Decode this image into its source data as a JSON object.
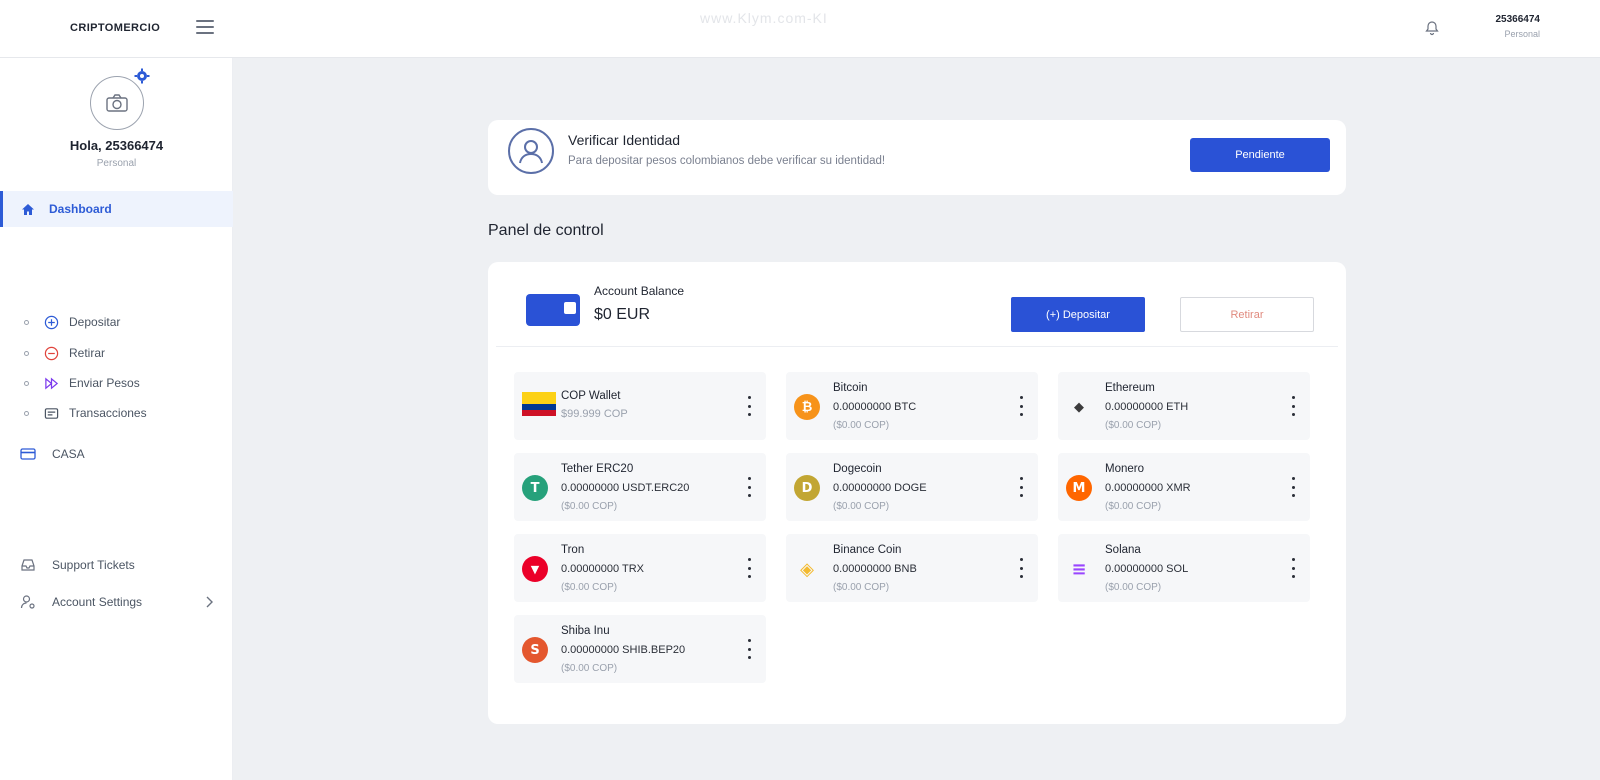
{
  "header": {
    "brand": "CRIPTOMERCIO",
    "watermark_url": "www.Klym.com-KI",
    "user_id": "25366474",
    "user_role": "Personal"
  },
  "sidebar": {
    "greeting": "Hola, 25366474",
    "account_type": "Personal",
    "active_item": "Dashboard",
    "sub_items": [
      {
        "label": "Depositar",
        "icon": "plus-circle-icon",
        "color": "#2d5bd6"
      },
      {
        "label": "Retirar",
        "icon": "minus-circle-icon",
        "color": "#e0433b"
      },
      {
        "label": "Enviar Pesos",
        "icon": "send-arrows-icon",
        "color": "#7c3aed"
      },
      {
        "label": "Transacciones",
        "icon": "list-icon",
        "color": "#4b5563"
      }
    ],
    "main_items": [
      {
        "label": "CASA",
        "icon": "card-icon"
      },
      {
        "label": "Support Tickets",
        "icon": "inbox-icon"
      },
      {
        "label": "Account Settings",
        "icon": "user-settings-icon"
      }
    ]
  },
  "verify": {
    "title": "Verificar Identidad",
    "subtitle": "Para depositar pesos colombianos debe verificar su identidad!",
    "button": "Pendiente"
  },
  "panel": {
    "title": "Panel de control",
    "balance_label": "Account Balance",
    "balance_value": "$0 EUR",
    "deposit_button": "(+) Depositar",
    "withdraw_button": "Retirar"
  },
  "assets": [
    {
      "name": "COP Wallet",
      "balance": "$99.999 COP",
      "value": "",
      "icon": "colombia-flag-icon",
      "color": "#fcd116"
    },
    {
      "name": "Bitcoin",
      "balance": "0.00000000 BTC",
      "value": "($0.00 COP)",
      "icon": "bitcoin-icon",
      "color": "#f7931a",
      "glyph": "₿"
    },
    {
      "name": "Ethereum",
      "balance": "0.00000000 ETH",
      "value": "($0.00 COP)",
      "icon": "ethereum-icon",
      "color": "#3c3c3d",
      "glyph": "◆"
    },
    {
      "name": "Tether ERC20",
      "balance": "0.00000000 USDT.ERC20",
      "value": "($0.00 COP)",
      "icon": "tether-icon",
      "color": "#26a17b",
      "glyph": "T"
    },
    {
      "name": "Dogecoin",
      "balance": "0.00000000 DOGE",
      "value": "($0.00 COP)",
      "icon": "dogecoin-icon",
      "color": "#c2a633",
      "glyph": "D"
    },
    {
      "name": "Monero",
      "balance": "0.00000000 XMR",
      "value": "($0.00 COP)",
      "icon": "monero-icon",
      "color": "#ff6600",
      "glyph": "M"
    },
    {
      "name": "Tron",
      "balance": "0.00000000 TRX",
      "value": "($0.00 COP)",
      "icon": "tron-icon",
      "color": "#eb0029",
      "glyph": "▼"
    },
    {
      "name": "Binance Coin",
      "balance": "0.00000000 BNB",
      "value": "($0.00 COP)",
      "icon": "binance-icon",
      "color": "#f3ba2f",
      "glyph": "◈"
    },
    {
      "name": "Solana",
      "balance": "0.00000000 SOL",
      "value": "($0.00 COP)",
      "icon": "solana-icon",
      "color": "#9945ff",
      "glyph": "≡"
    },
    {
      "name": "Shiba Inu",
      "balance": "0.00000000 SHIB.BEP20",
      "value": "($0.00 COP)",
      "icon": "shiba-inu-icon",
      "color": "#e4572e",
      "glyph": "S"
    }
  ],
  "colors": {
    "accent": "#2a52d6",
    "danger_text": "#e08a7e",
    "page_bg": "#eef0f3"
  }
}
